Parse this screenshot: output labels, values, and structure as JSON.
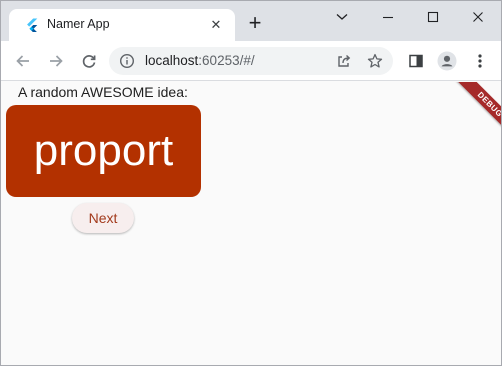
{
  "browser": {
    "tab": {
      "title": "Namer App",
      "close_glyph": "✕"
    },
    "new_tab_glyph": "+",
    "url_host": "localhost",
    "url_rest": ":60253/#/"
  },
  "app": {
    "label": "A random AWESOME idea:",
    "word": "proport",
    "next_label": "Next",
    "debug_label": "DEBUG",
    "colors": {
      "card": "#b33100",
      "card_text": "#ffffff",
      "button_bg": "#f7eeee",
      "button_text": "#a23a1c",
      "debug": "#a52a2a"
    }
  }
}
